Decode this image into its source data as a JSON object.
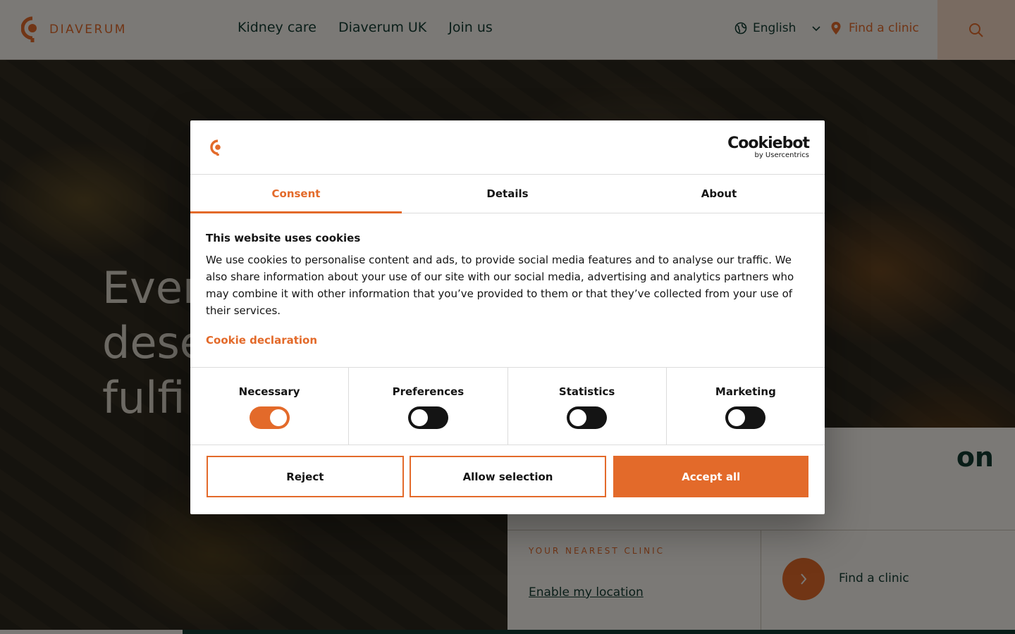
{
  "header": {
    "logo_text": "DIAVERUM",
    "nav": [
      "Kidney care",
      "Diaverum UK",
      "Join us"
    ],
    "language": "English",
    "find_clinic": "Find a clinic"
  },
  "hero": {
    "title_lines": [
      "Ever",
      "dese",
      "fulfi"
    ],
    "info_heading": "on",
    "nearest_label": "YOUR NEAREST CLINIC",
    "enable_location": "Enable my location",
    "find_clinic": "Find a clinic"
  },
  "cookie_dialog": {
    "brand": "Cookiebot",
    "brand_sub": "by Usercentrics",
    "tabs": [
      "Consent",
      "Details",
      "About"
    ],
    "active_tab": "Consent",
    "title": "This website uses cookies",
    "text": "We use cookies to personalise content and ads, to provide social media features and to analyse our traffic. We also share information about your use of our site with our social media, advertising and analytics partners who may combine it with other information that you’ve provided to them or that they’ve collected from your use of their services.",
    "declaration_link": "Cookie declaration",
    "toggles": [
      {
        "label": "Necessary",
        "on": true
      },
      {
        "label": "Preferences",
        "on": false
      },
      {
        "label": "Statistics",
        "on": false
      },
      {
        "label": "Marketing",
        "on": false
      }
    ],
    "buttons": {
      "reject": "Reject",
      "allow": "Allow selection",
      "accept": "Accept all"
    }
  },
  "colors": {
    "accent": "#e36a2a",
    "dark_green": "#123b31",
    "cream": "#f6f2ec"
  }
}
